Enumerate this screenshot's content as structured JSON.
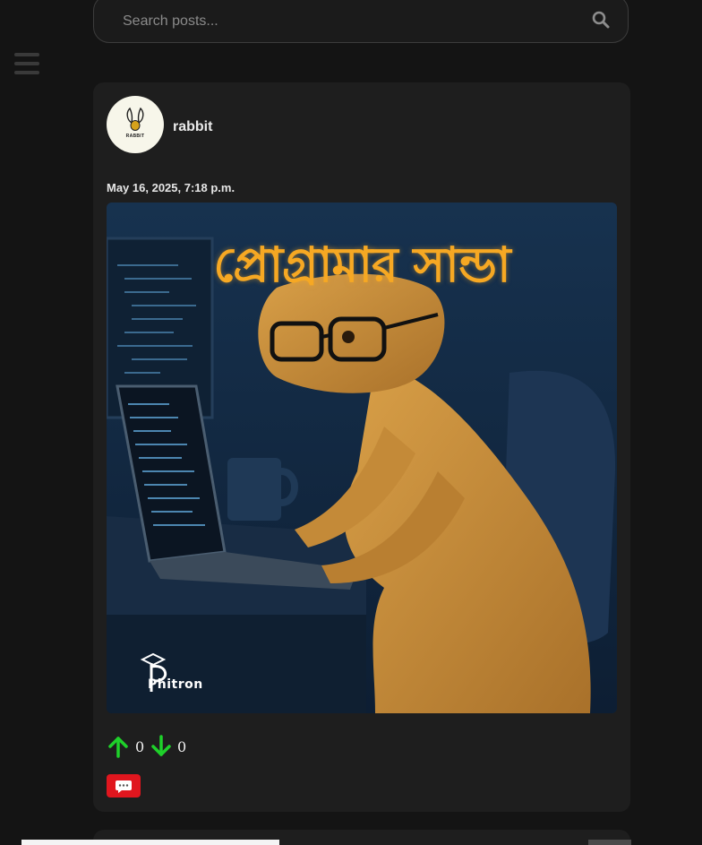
{
  "search": {
    "placeholder": "Search posts..."
  },
  "post": {
    "username": "rabbit",
    "avatar_text": "RABBIT",
    "timestamp": "May 16, 2025, 7:18 p.m.",
    "image": {
      "title": "প্রোগ্রামার সান্ডা",
      "brand": "Phitron"
    },
    "upvotes": "0",
    "downvotes": "0"
  },
  "colors": {
    "background": "#141414",
    "card": "#1e1e1e",
    "vote_arrow": "#1ed12a",
    "comment_button": "#e0161e"
  },
  "icons": {
    "menu": "hamburger-icon",
    "search": "search-icon",
    "upvote": "arrow-up-icon",
    "downvote": "arrow-down-icon",
    "comment": "speech-bubble-icon"
  }
}
